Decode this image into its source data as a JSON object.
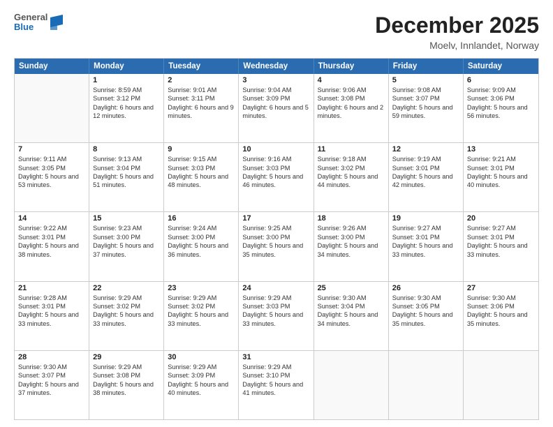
{
  "header": {
    "logo": {
      "general": "General",
      "blue": "Blue"
    },
    "title": "December 2025",
    "location": "Moelv, Innlandet, Norway"
  },
  "calendar": {
    "days_of_week": [
      "Sunday",
      "Monday",
      "Tuesday",
      "Wednesday",
      "Thursday",
      "Friday",
      "Saturday"
    ],
    "weeks": [
      [
        {
          "day": null
        },
        {
          "day": "1",
          "sunrise": "Sunrise: 8:59 AM",
          "sunset": "Sunset: 3:12 PM",
          "daylight": "Daylight: 6 hours and 12 minutes."
        },
        {
          "day": "2",
          "sunrise": "Sunrise: 9:01 AM",
          "sunset": "Sunset: 3:11 PM",
          "daylight": "Daylight: 6 hours and 9 minutes."
        },
        {
          "day": "3",
          "sunrise": "Sunrise: 9:04 AM",
          "sunset": "Sunset: 3:09 PM",
          "daylight": "Daylight: 6 hours and 5 minutes."
        },
        {
          "day": "4",
          "sunrise": "Sunrise: 9:06 AM",
          "sunset": "Sunset: 3:08 PM",
          "daylight": "Daylight: 6 hours and 2 minutes."
        },
        {
          "day": "5",
          "sunrise": "Sunrise: 9:08 AM",
          "sunset": "Sunset: 3:07 PM",
          "daylight": "Daylight: 5 hours and 59 minutes."
        },
        {
          "day": "6",
          "sunrise": "Sunrise: 9:09 AM",
          "sunset": "Sunset: 3:06 PM",
          "daylight": "Daylight: 5 hours and 56 minutes."
        }
      ],
      [
        {
          "day": "7",
          "sunrise": "Sunrise: 9:11 AM",
          "sunset": "Sunset: 3:05 PM",
          "daylight": "Daylight: 5 hours and 53 minutes."
        },
        {
          "day": "8",
          "sunrise": "Sunrise: 9:13 AM",
          "sunset": "Sunset: 3:04 PM",
          "daylight": "Daylight: 5 hours and 51 minutes."
        },
        {
          "day": "9",
          "sunrise": "Sunrise: 9:15 AM",
          "sunset": "Sunset: 3:03 PM",
          "daylight": "Daylight: 5 hours and 48 minutes."
        },
        {
          "day": "10",
          "sunrise": "Sunrise: 9:16 AM",
          "sunset": "Sunset: 3:03 PM",
          "daylight": "Daylight: 5 hours and 46 minutes."
        },
        {
          "day": "11",
          "sunrise": "Sunrise: 9:18 AM",
          "sunset": "Sunset: 3:02 PM",
          "daylight": "Daylight: 5 hours and 44 minutes."
        },
        {
          "day": "12",
          "sunrise": "Sunrise: 9:19 AM",
          "sunset": "Sunset: 3:01 PM",
          "daylight": "Daylight: 5 hours and 42 minutes."
        },
        {
          "day": "13",
          "sunrise": "Sunrise: 9:21 AM",
          "sunset": "Sunset: 3:01 PM",
          "daylight": "Daylight: 5 hours and 40 minutes."
        }
      ],
      [
        {
          "day": "14",
          "sunrise": "Sunrise: 9:22 AM",
          "sunset": "Sunset: 3:01 PM",
          "daylight": "Daylight: 5 hours and 38 minutes."
        },
        {
          "day": "15",
          "sunrise": "Sunrise: 9:23 AM",
          "sunset": "Sunset: 3:00 PM",
          "daylight": "Daylight: 5 hours and 37 minutes."
        },
        {
          "day": "16",
          "sunrise": "Sunrise: 9:24 AM",
          "sunset": "Sunset: 3:00 PM",
          "daylight": "Daylight: 5 hours and 36 minutes."
        },
        {
          "day": "17",
          "sunrise": "Sunrise: 9:25 AM",
          "sunset": "Sunset: 3:00 PM",
          "daylight": "Daylight: 5 hours and 35 minutes."
        },
        {
          "day": "18",
          "sunrise": "Sunrise: 9:26 AM",
          "sunset": "Sunset: 3:00 PM",
          "daylight": "Daylight: 5 hours and 34 minutes."
        },
        {
          "day": "19",
          "sunrise": "Sunrise: 9:27 AM",
          "sunset": "Sunset: 3:01 PM",
          "daylight": "Daylight: 5 hours and 33 minutes."
        },
        {
          "day": "20",
          "sunrise": "Sunrise: 9:27 AM",
          "sunset": "Sunset: 3:01 PM",
          "daylight": "Daylight: 5 hours and 33 minutes."
        }
      ],
      [
        {
          "day": "21",
          "sunrise": "Sunrise: 9:28 AM",
          "sunset": "Sunset: 3:01 PM",
          "daylight": "Daylight: 5 hours and 33 minutes."
        },
        {
          "day": "22",
          "sunrise": "Sunrise: 9:29 AM",
          "sunset": "Sunset: 3:02 PM",
          "daylight": "Daylight: 5 hours and 33 minutes."
        },
        {
          "day": "23",
          "sunrise": "Sunrise: 9:29 AM",
          "sunset": "Sunset: 3:02 PM",
          "daylight": "Daylight: 5 hours and 33 minutes."
        },
        {
          "day": "24",
          "sunrise": "Sunrise: 9:29 AM",
          "sunset": "Sunset: 3:03 PM",
          "daylight": "Daylight: 5 hours and 33 minutes."
        },
        {
          "day": "25",
          "sunrise": "Sunrise: 9:30 AM",
          "sunset": "Sunset: 3:04 PM",
          "daylight": "Daylight: 5 hours and 34 minutes."
        },
        {
          "day": "26",
          "sunrise": "Sunrise: 9:30 AM",
          "sunset": "Sunset: 3:05 PM",
          "daylight": "Daylight: 5 hours and 35 minutes."
        },
        {
          "day": "27",
          "sunrise": "Sunrise: 9:30 AM",
          "sunset": "Sunset: 3:06 PM",
          "daylight": "Daylight: 5 hours and 35 minutes."
        }
      ],
      [
        {
          "day": "28",
          "sunrise": "Sunrise: 9:30 AM",
          "sunset": "Sunset: 3:07 PM",
          "daylight": "Daylight: 5 hours and 37 minutes."
        },
        {
          "day": "29",
          "sunrise": "Sunrise: 9:29 AM",
          "sunset": "Sunset: 3:08 PM",
          "daylight": "Daylight: 5 hours and 38 minutes."
        },
        {
          "day": "30",
          "sunrise": "Sunrise: 9:29 AM",
          "sunset": "Sunset: 3:09 PM",
          "daylight": "Daylight: 5 hours and 40 minutes."
        },
        {
          "day": "31",
          "sunrise": "Sunrise: 9:29 AM",
          "sunset": "Sunset: 3:10 PM",
          "daylight": "Daylight: 5 hours and 41 minutes."
        },
        {
          "day": null
        },
        {
          "day": null
        },
        {
          "day": null
        }
      ]
    ]
  }
}
